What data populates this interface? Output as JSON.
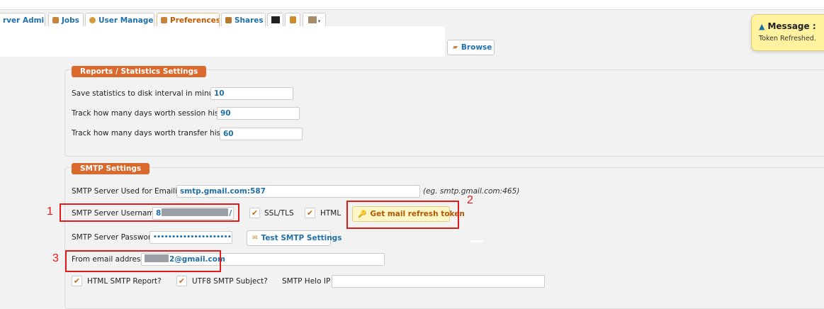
{
  "tabs": [
    {
      "label": "rver Admin",
      "icon": "server-icon"
    },
    {
      "label": "Jobs",
      "icon": "jobs-icon"
    },
    {
      "label": "User Manager",
      "icon": "user-icon"
    },
    {
      "label": "Preferences",
      "icon": "preferences-icon"
    },
    {
      "label": "Shares",
      "icon": "shares-icon"
    }
  ],
  "toolbar": {
    "browse_label": "Browse"
  },
  "reports": {
    "legend": "Reports / Statistics Settings",
    "save_interval_label": "Save statistics to disk interval in minutes :",
    "save_interval_value": "10",
    "session_history_label": "Track how many days worth session history :",
    "session_history_value": "90",
    "transfer_history_label": "Track how many days worth transfer history :",
    "transfer_history_value": "60"
  },
  "smtp": {
    "legend": "SMTP Settings",
    "server_label": "SMTP Server Used for Emailing :",
    "server_value": "smtp.gmail.com:587",
    "server_hint": "(eg. smtp.gmail.com:465)",
    "username_label": "SMTP Server Username :",
    "username_visible_prefix": "8",
    "username_visible_suffix": "/",
    "ssl_label": "SSL/TLS",
    "ssl_checked": true,
    "html_label": "HTML",
    "html_checked": true,
    "refresh_token_label": "Get mail refresh token",
    "password_label": "SMTP Server Password :",
    "password_value": "•••••••••••••••••••••",
    "test_label": "Test SMTP Settings",
    "from_label": "From email address :",
    "from_value_suffix": "2@gmail.com",
    "html_report_label": "HTML SMTP Report?",
    "utf8_subject_label": "UTF8 SMTP Subject?",
    "helo_label": "SMTP Helo IP :",
    "helo_value": ""
  },
  "annotations": [
    "1",
    "2",
    "3"
  ],
  "message": {
    "title": "Message :",
    "body": "Token Refreshed."
  },
  "colors": {
    "accent": "#d9692c",
    "link": "#1f6fa8",
    "annotation": "#e21b1b",
    "message_bg": "#fff3a0"
  }
}
